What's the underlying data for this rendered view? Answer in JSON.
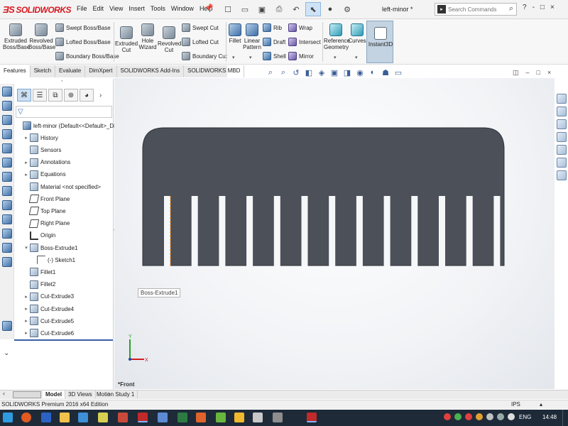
{
  "app": {
    "brand": "SOLIDWORKS",
    "doc_title": "left-minor *"
  },
  "menu": [
    "File",
    "Edit",
    "View",
    "Insert",
    "Tools",
    "Window",
    "Help"
  ],
  "search": {
    "placeholder": "Search Commands"
  },
  "window_controls": [
    "?",
    "-",
    "□",
    "×"
  ],
  "commands": {
    "extruded_boss": "Extruded\nBoss/Base",
    "revolved_boss": "Revolved\nBoss/Base",
    "swept_boss": "Swept Boss/Base",
    "lofted_boss": "Lofted Boss/Base",
    "boundary_boss": "Boundary Boss/Base",
    "extruded_cut": "Extruded\nCut",
    "hole_wizard": "Hole\nWizard",
    "revolved_cut": "Revolved\nCut",
    "swept_cut": "Swept Cut",
    "lofted_cut": "Lofted Cut",
    "boundary_cut": "Boundary Cut",
    "fillet": "Fillet",
    "linear_pattern": "Linear\nPattern",
    "rib": "Rib",
    "draft": "Draft",
    "shell": "Shell",
    "wrap": "Wrap",
    "intersect": "Intersect",
    "mirror": "Mirror",
    "reference_geometry": "Reference\nGeometry",
    "curves": "Curves",
    "instant3d": "Instant3D"
  },
  "tabs": [
    "Features",
    "Sketch",
    "Evaluate",
    "DimXpert",
    "SOLIDWORKS Add-Ins",
    "SOLIDWORKS MBD"
  ],
  "tree": [
    {
      "label": "left-minor  (Default<<Default>_Display S",
      "icon": "part",
      "expander": "",
      "indent": 0
    },
    {
      "label": "History",
      "icon": "folder",
      "expander": "▸",
      "indent": 1
    },
    {
      "label": "Sensors",
      "icon": "folder",
      "expander": "",
      "indent": 1
    },
    {
      "label": "Annotations",
      "icon": "folder",
      "expander": "▸",
      "indent": 1
    },
    {
      "label": "Equations",
      "icon": "folder",
      "expander": "▸",
      "indent": 1
    },
    {
      "label": "Material <not specified>",
      "icon": "folder",
      "expander": "",
      "indent": 1
    },
    {
      "label": "Front Plane",
      "icon": "plane",
      "expander": "",
      "indent": 1
    },
    {
      "label": "Top Plane",
      "icon": "plane",
      "expander": "",
      "indent": 1
    },
    {
      "label": "Right Plane",
      "icon": "plane",
      "expander": "",
      "indent": 1
    },
    {
      "label": "Origin",
      "icon": "origin",
      "expander": "",
      "indent": 1
    },
    {
      "label": "Boss-Extrude1",
      "icon": "feature",
      "expander": "▾",
      "indent": 1
    },
    {
      "label": "(-) Sketch1",
      "icon": "sketch",
      "expander": "",
      "indent": 2
    },
    {
      "label": "Fillet1",
      "icon": "feature",
      "expander": "",
      "indent": 1
    },
    {
      "label": "Fillet2",
      "icon": "feature",
      "expander": "",
      "indent": 1
    },
    {
      "label": "Cut-Extrude3",
      "icon": "feature",
      "expander": "▸",
      "indent": 1
    },
    {
      "label": "Cut-Extrude4",
      "icon": "feature",
      "expander": "▸",
      "indent": 1
    },
    {
      "label": "Cut-Extrude5",
      "icon": "feature",
      "expander": "▸",
      "indent": 1
    },
    {
      "label": "Cut-Extrude6",
      "icon": "feature",
      "expander": "▸",
      "indent": 1
    }
  ],
  "tooltip": "Boss-Extrude1",
  "view_label": "*Front",
  "bottom_tabs": [
    "Model",
    "3D Views",
    "Motion Study 1"
  ],
  "status": {
    "edition": "SOLIDWORKS Premium 2016 x64 Edition",
    "units": "IPS"
  },
  "taskbar": {
    "lang": "ENG",
    "clock": "14:48"
  },
  "colors": {
    "part": "#4b5059",
    "accent": "#3a5fa6",
    "brand": "#d71920"
  }
}
